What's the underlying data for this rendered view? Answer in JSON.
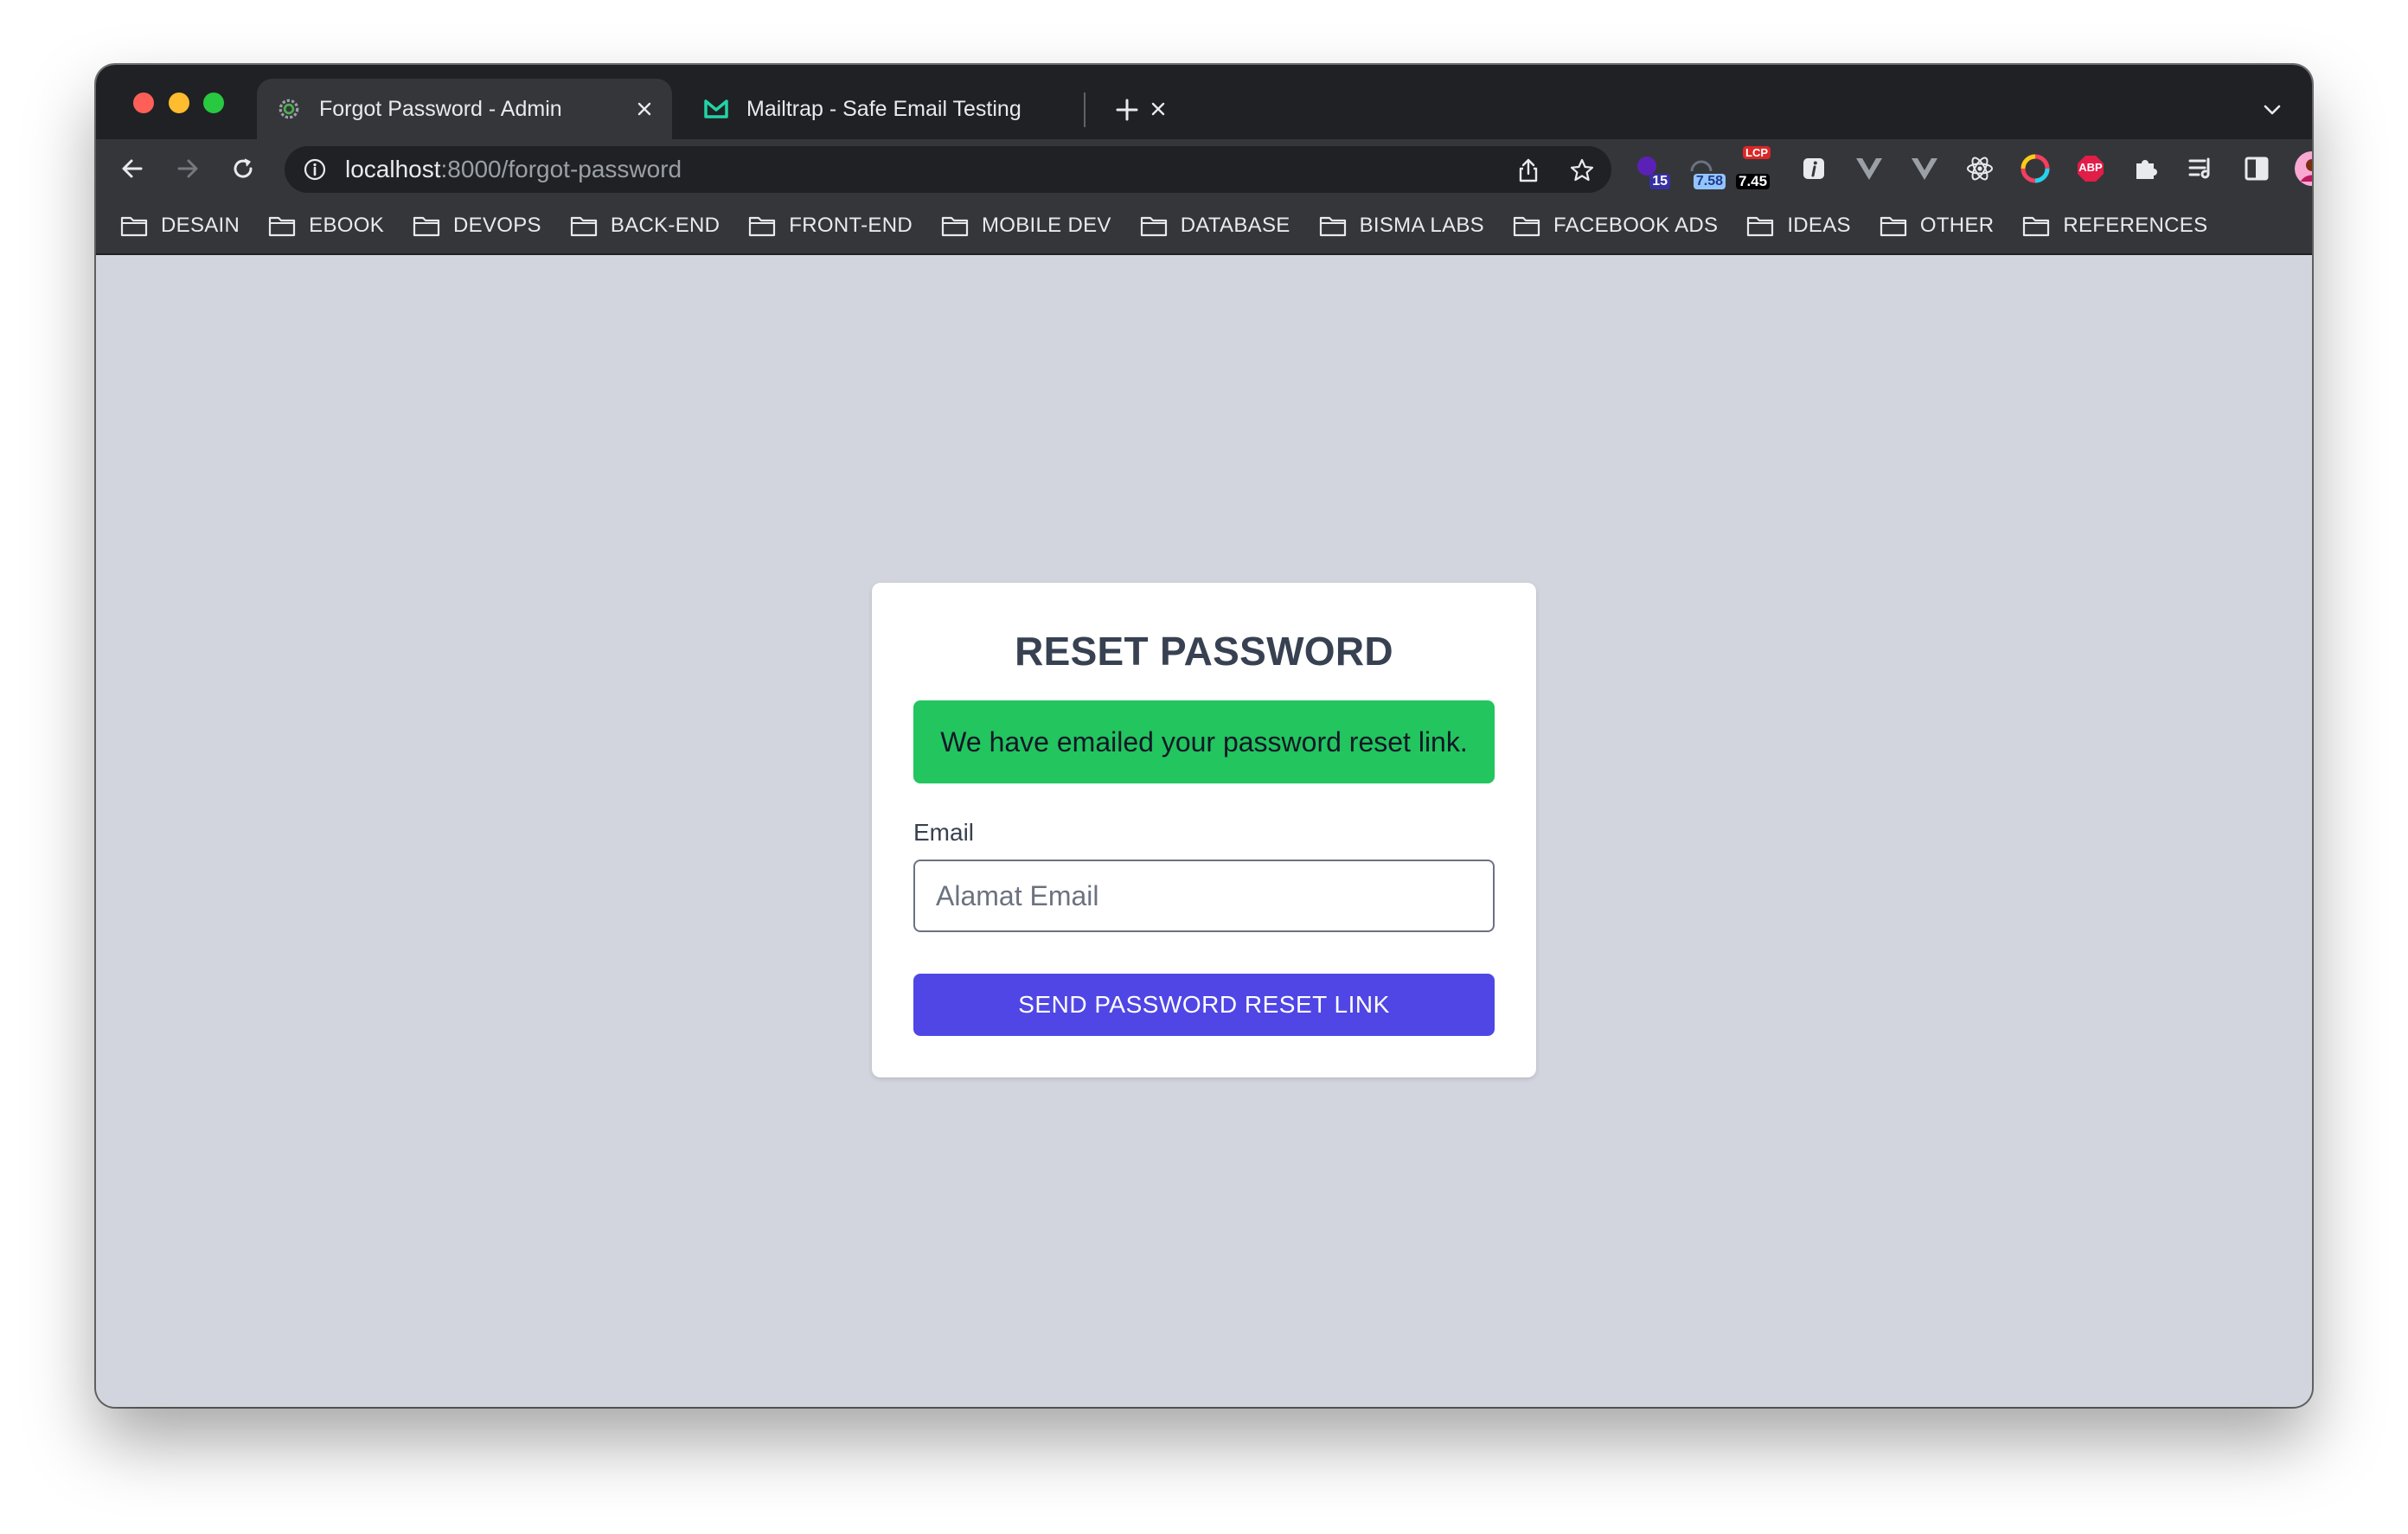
{
  "browser": {
    "tabs": [
      {
        "title": "Forgot Password - Admin",
        "favicon": "gear-favicon-icon",
        "active": true
      },
      {
        "title": "Mailtrap - Safe Email Testing",
        "favicon": "mailtrap-logo-icon",
        "active": false
      }
    ],
    "url": {
      "host": "localhost",
      "path": ":8000/forgot-password"
    },
    "extensions": [
      {
        "name": "extension-purple-icon",
        "badge": "15"
      },
      {
        "name": "extension-speed-icon",
        "badge": "7.58"
      },
      {
        "name": "lcp-extension-icon",
        "top_label": "LCP",
        "badge": "7.45"
      },
      {
        "name": "info-extension-icon"
      },
      {
        "name": "vue-devtools-icon"
      },
      {
        "name": "vue-devtools-alt-icon"
      },
      {
        "name": "react-devtools-icon"
      },
      {
        "name": "color-picker-extension-icon"
      },
      {
        "name": "adblock-icon",
        "label": "ABP"
      },
      {
        "name": "extensions-puzzle-icon"
      },
      {
        "name": "reading-list-icon"
      },
      {
        "name": "side-panel-icon"
      },
      {
        "name": "profile-avatar-icon"
      },
      {
        "name": "more-menu-icon"
      }
    ],
    "bookmarks": [
      "DESAIN",
      "EBOOK",
      "DEVOPS",
      "BACK-END",
      "FRONT-END",
      "MOBILE DEV",
      "DATABASE",
      "BISMA LABS",
      "FACEBOOK ADS",
      "IDEAS",
      "OTHER",
      "REFERENCES"
    ]
  },
  "page": {
    "heading": "RESET PASSWORD",
    "alert": "We have emailed your password reset link.",
    "email_label": "Email",
    "email_placeholder": "Alamat Email",
    "email_value": "",
    "submit_label": "SEND PASSWORD RESET LINK"
  },
  "colors": {
    "page_background": "#d2d5de",
    "alert_success": "#22c55e",
    "primary_button": "#4f46e5",
    "browser_chrome": "#35363a"
  }
}
